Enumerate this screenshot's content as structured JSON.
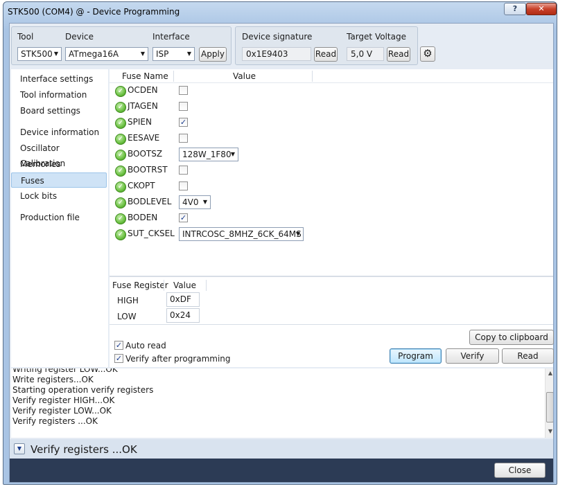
{
  "window": {
    "title": "STK500 (COM4) @  - Device Programming",
    "help_label": "?",
    "close_label": "✕"
  },
  "toolbar": {
    "tool_label": "Tool",
    "device_label": "Device",
    "interface_label": "Interface",
    "tool_value": "STK500",
    "device_value": "ATmega16A",
    "interface_value": "ISP",
    "apply_label": "Apply",
    "signature_label": "Device signature",
    "signature_value": "0x1E9403",
    "signature_read": "Read",
    "voltage_label": "Target Voltage",
    "voltage_value": "5,0 V",
    "voltage_read": "Read",
    "settings_icon": "gear-icon"
  },
  "nav": {
    "items": [
      {
        "label": "Interface settings"
      },
      {
        "label": "Tool information"
      },
      {
        "label": "Board settings"
      },
      {
        "label": "Device information"
      },
      {
        "label": "Oscillator Calibration"
      },
      {
        "label": "Memories"
      },
      {
        "label": "Fuses",
        "selected": true
      },
      {
        "label": "Lock bits"
      },
      {
        "label": "Production file"
      }
    ]
  },
  "fuses": {
    "col_name": "Fuse Name",
    "col_value": "Value",
    "rows": [
      {
        "name": "OCDEN",
        "type": "checkbox",
        "checked": false
      },
      {
        "name": "JTAGEN",
        "type": "checkbox",
        "checked": false
      },
      {
        "name": "SPIEN",
        "type": "checkbox",
        "checked": true
      },
      {
        "name": "EESAVE",
        "type": "checkbox",
        "checked": false
      },
      {
        "name": "BOOTSZ",
        "type": "select",
        "value": "128W_1F80"
      },
      {
        "name": "BOOTRST",
        "type": "checkbox",
        "checked": false
      },
      {
        "name": "CKOPT",
        "type": "checkbox",
        "checked": false
      },
      {
        "name": "BODLEVEL",
        "type": "select",
        "value": "4V0"
      },
      {
        "name": "BODEN",
        "type": "checkbox",
        "checked": true
      },
      {
        "name": "SUT_CKSEL",
        "type": "select",
        "value": "INTRCOSC_8MHZ_6CK_64MS"
      }
    ]
  },
  "registers": {
    "col_reg": "Fuse Register",
    "col_value": "Value",
    "rows": [
      {
        "name": "HIGH",
        "value": "0xDF"
      },
      {
        "name": "LOW",
        "value": "0x24"
      }
    ]
  },
  "options": {
    "auto_read_label": "Auto read",
    "auto_read_checked": true,
    "verify_label": "Verify after programming",
    "verify_checked": true
  },
  "actions": {
    "copy_label": "Copy to clipboard",
    "program_label": "Program",
    "verify_label": "Verify",
    "read_label": "Read"
  },
  "log": {
    "lines": [
      "Writing register LOW...OK",
      "Write registers...OK",
      "Starting operation verify registers",
      "Verify register HIGH...OK",
      "Verify register LOW...OK",
      "Verify registers ...OK"
    ]
  },
  "status": {
    "text": "Verify registers ...OK"
  },
  "footer": {
    "close_label": "Close"
  },
  "colors": {
    "accent": "#2c3b55",
    "check_green": "#6cc143",
    "selection": "#cfe3f6"
  }
}
